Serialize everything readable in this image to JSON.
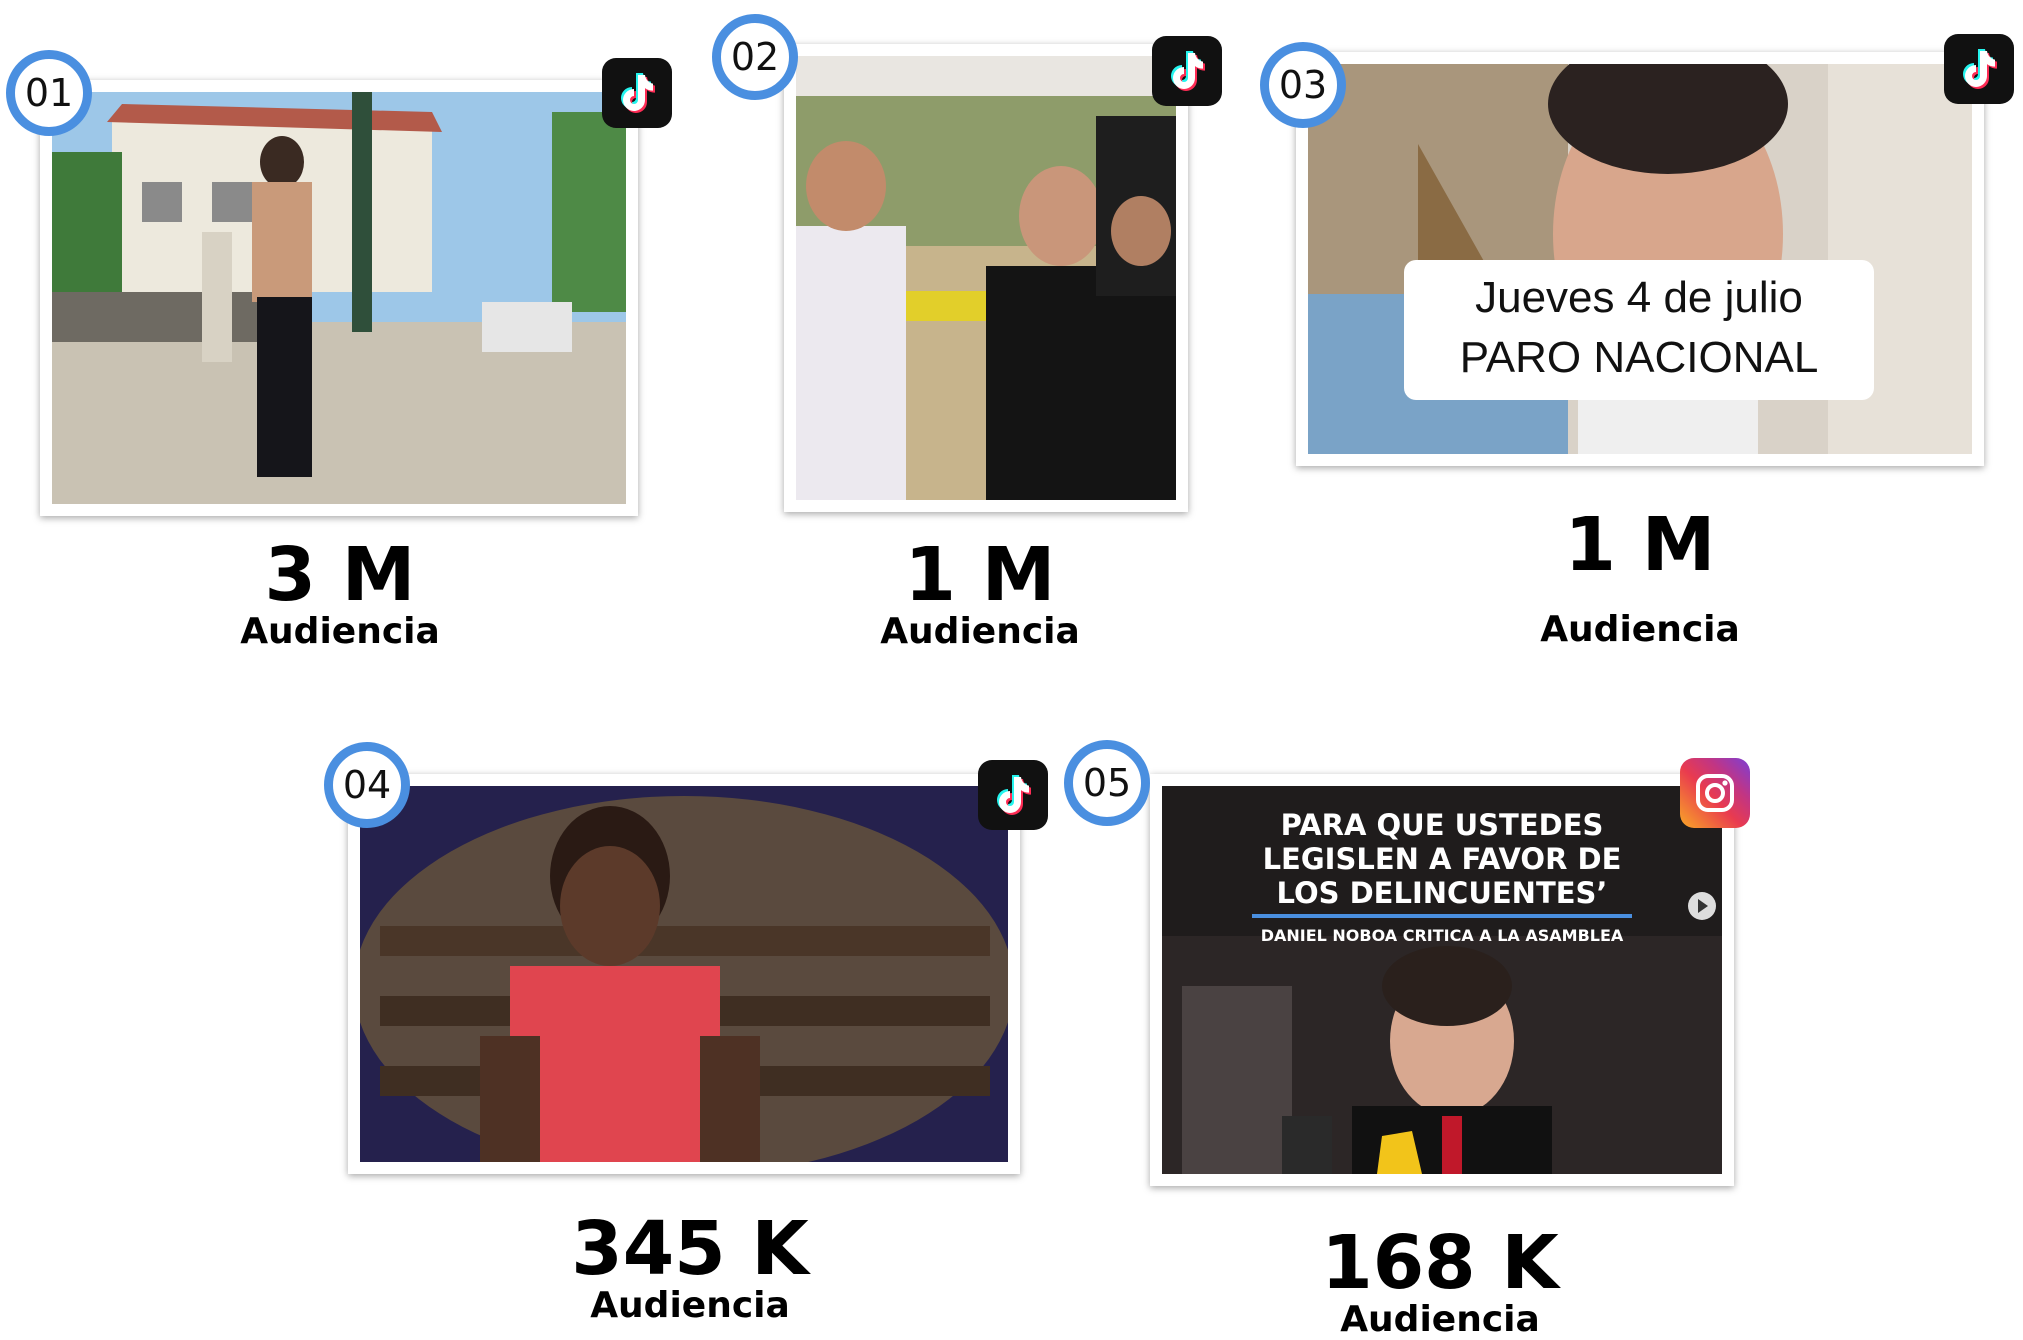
{
  "colors": {
    "badge_ring": "#4a8fe0",
    "tiktok_bg": "#111111",
    "metric_text": "#000000"
  },
  "cards": [
    {
      "number": "01",
      "platform_icon": "tiktok-icon",
      "audience_value": "3 M",
      "audience_label": "Audiencia"
    },
    {
      "number": "02",
      "platform_icon": "tiktok-icon",
      "audience_value": "1 M",
      "audience_label": "Audiencia"
    },
    {
      "number": "03",
      "platform_icon": "tiktok-icon",
      "overlay_line1": "Jueves 4 de julio",
      "overlay_line2": "PARO NACIONAL",
      "audience_value": "1 M",
      "audience_label": "Audiencia"
    },
    {
      "number": "04",
      "platform_icon": "tiktok-icon",
      "audience_value": "345 K",
      "audience_label": "Audiencia"
    },
    {
      "number": "05",
      "platform_icon": "instagram-icon",
      "headline_lines": [
        "PARA QUE USTEDES",
        "LEGISLEN A FAVOR DE",
        "LOS DELINCUENTES’"
      ],
      "subheadline": "DANIEL NOBOA CRITICA A LA ASAMBLEA",
      "audience_value": "168 K",
      "audience_label": "Audiencia"
    }
  ]
}
